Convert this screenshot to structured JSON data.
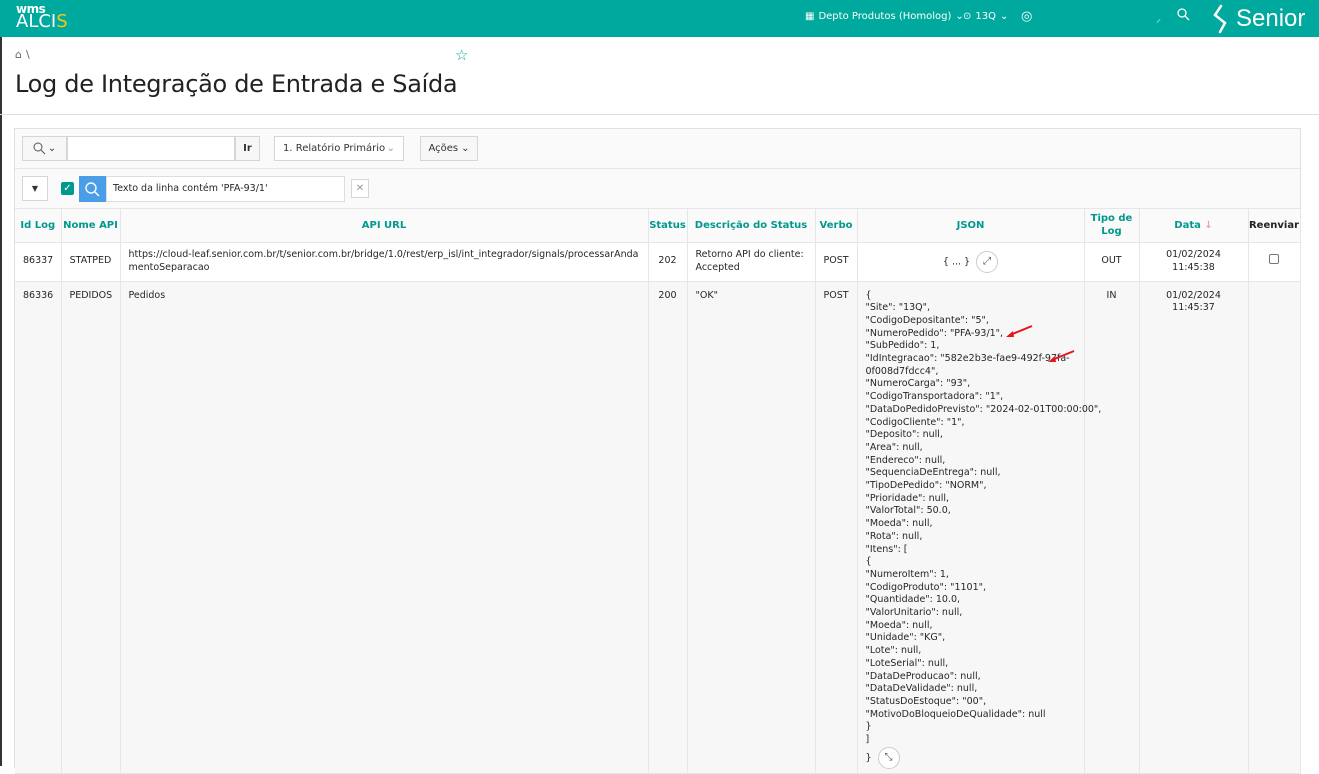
{
  "header": {
    "logo_top": "wms",
    "logo_main": "ALCI",
    "logo_accent": "S",
    "depot": "Depto Produtos (Homolog)",
    "site": "13Q",
    "brand": "Senior"
  },
  "page": {
    "breadcrumb_sep": "\\",
    "title": "Log de Integração de Entrada e Saída"
  },
  "toolbar": {
    "search_value": "",
    "go_label": "Ir",
    "report_select": "1. Relatório Primário",
    "actions_label": "Ações"
  },
  "filter": {
    "text": "Texto da linha contém 'PFA-93/1'"
  },
  "table": {
    "columns": [
      "Id Log",
      "Nome API",
      "API URL",
      "Status",
      "Descrição do Status",
      "Verbo",
      "JSON",
      "Tipo de Log",
      "Data",
      "Reenviar"
    ],
    "rows": [
      {
        "id": "86337",
        "api": "STATPED",
        "url": "https://cloud-leaf.senior.com.br/t/senior.com.br/bridge/1.0/rest/erp_isl/int_integrador/signals/processarAndamentoSeparacao",
        "status": "202",
        "desc": "Retorno API do cliente: Accepted",
        "verb": "POST",
        "json": "{ ... }",
        "type": "OUT",
        "date": "01/02/2024 11:45:38"
      },
      {
        "id": "86336",
        "api": "PEDIDOS",
        "url": "Pedidos",
        "status": "200",
        "desc": "\"OK\"",
        "verb": "POST",
        "type": "IN",
        "date": "01/02/2024 11:45:37",
        "json_lines": [
          "{",
          "\"Site\": \"13Q\",",
          "\"CodigoDepositante\": \"5\",",
          "\"NumeroPedido\": \"PFA-93/1\",",
          "\"SubPedido\": 1,",
          "\"IdIntegracao\": \"582e2b3e-fae9-492f-97fa-",
          "0f008d7fdcc4\",",
          "\"NumeroCarga\": \"93\",",
          "\"CodigoTransportadora\": \"1\",",
          "\"DataDoPedidoPrevisto\": \"2024-02-01T00:00:00\",",
          "\"CodigoCliente\": \"1\",",
          "\"Deposito\": null,",
          "\"Area\": null,",
          "\"Endereco\": null,",
          "\"SequenciaDeEntrega\": null,",
          "\"TipoDePedido\": \"NORM\",",
          "\"Prioridade\": null,",
          "\"ValorTotal\": 50.0,",
          "\"Moeda\": null,",
          "\"Rota\": null,",
          "\"Itens\": [",
          "{",
          "\"NumeroItem\": 1,",
          "\"CodigoProduto\": \"1101\",",
          "\"Quantidade\": 10.0,",
          "\"ValorUnitario\": null,",
          "\"Moeda\": null,",
          "\"Unidade\": \"KG\",",
          "\"Lote\": null,",
          "\"LoteSerial\": null,",
          "\"DataDeProducao\": null,",
          "\"DataDeValidade\": null,",
          "\"StatusDoEstoque\": \"00\",",
          "\"MotivoDoBloqueioDeQualidade\": null",
          "}",
          "]",
          "}"
        ]
      }
    ]
  },
  "annotation_color": "#e8141b"
}
